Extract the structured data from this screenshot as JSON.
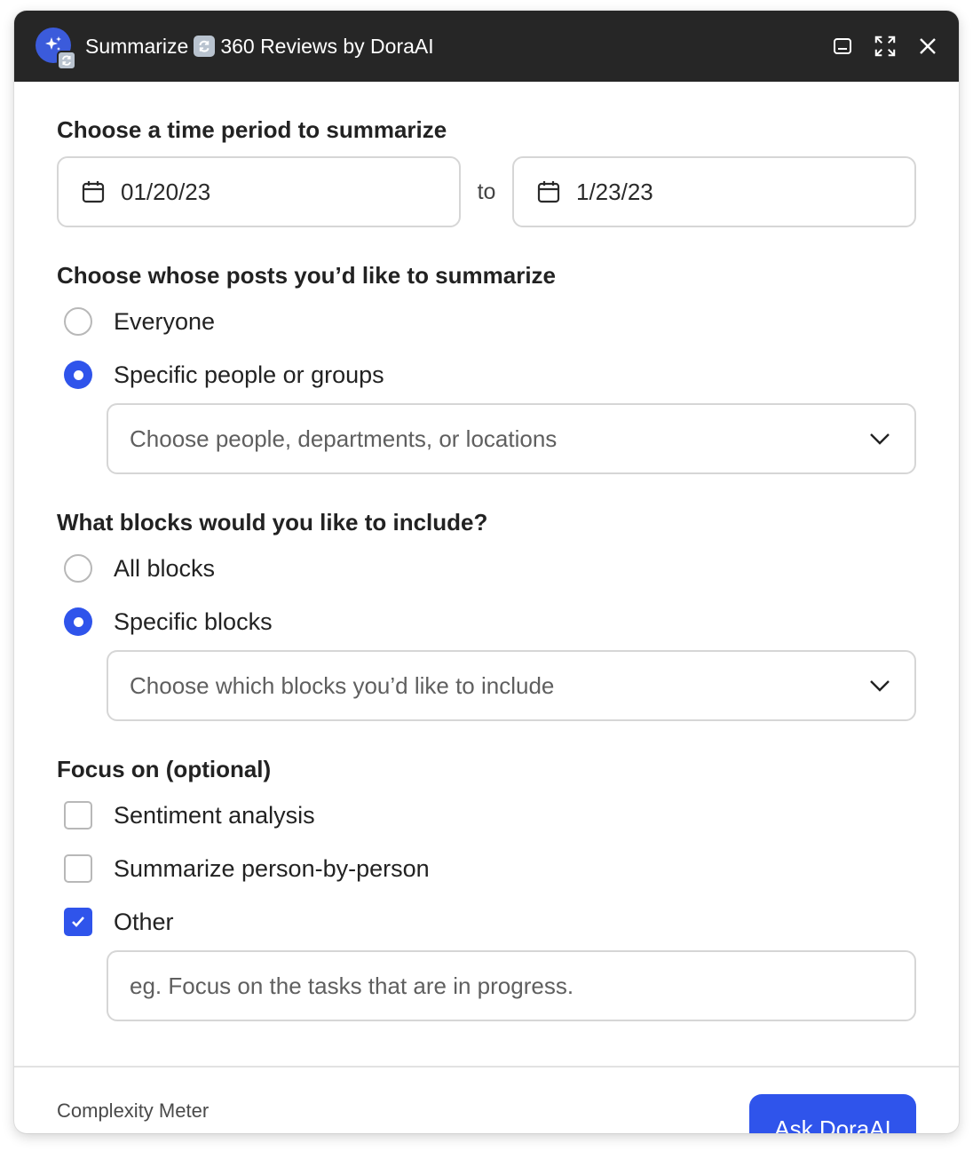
{
  "window": {
    "title_prefix": "Summarize",
    "title_suffix": "360 Reviews by DoraAI",
    "icons": [
      "sparkle-icon",
      "sync-icon",
      "minimize-icon",
      "expand-icon",
      "close-icon"
    ]
  },
  "time_period": {
    "heading": "Choose a time period to summarize",
    "start_date": "01/20/23",
    "to_label": "to",
    "end_date": "1/23/23"
  },
  "posts": {
    "heading": "Choose whose posts you’d like to summarize",
    "options": [
      {
        "label": "Everyone",
        "selected": false
      },
      {
        "label": "Specific people or groups",
        "selected": true
      }
    ],
    "select_placeholder": "Choose people, departments, or locations"
  },
  "blocks": {
    "heading": "What blocks would you like to include?",
    "options": [
      {
        "label": "All blocks",
        "selected": false
      },
      {
        "label": "Specific blocks",
        "selected": true
      }
    ],
    "select_placeholder": "Choose which blocks you’d like to include"
  },
  "focus": {
    "heading": "Focus on (optional)",
    "options": [
      {
        "label": "Sentiment analysis",
        "checked": false
      },
      {
        "label": "Summarize person-by-person",
        "checked": false
      },
      {
        "label": "Other",
        "checked": true
      }
    ],
    "other_placeholder": "eg. Focus on the tasks that are in progress."
  },
  "footer": {
    "meter_label": "Complexity Meter",
    "ask_button": "Ask DoraAI"
  },
  "colors": {
    "titlebar": "#262626",
    "accent": "#2f54eb",
    "border": "#d6d6d6"
  }
}
